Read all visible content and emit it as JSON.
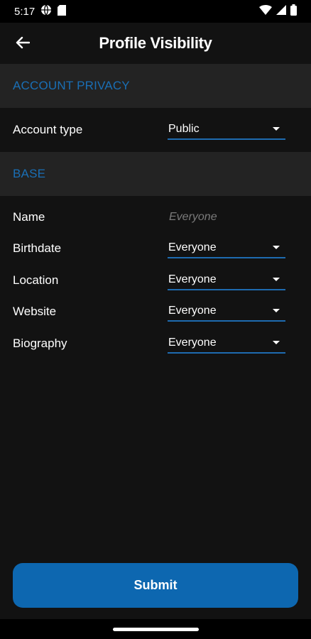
{
  "status_bar": {
    "time": "5:17",
    "icons": [
      "globe-icon",
      "sd-card-icon",
      "wifi-icon",
      "signal-icon",
      "battery-icon"
    ]
  },
  "app_bar": {
    "title": "Profile Visibility",
    "back_icon": "arrow-left-icon"
  },
  "sections": {
    "account_privacy": {
      "header": "ACCOUNT PRIVACY",
      "account_type": {
        "label": "Account type",
        "value": "Public"
      }
    },
    "base": {
      "header": "BASE",
      "name": {
        "label": "Name",
        "value": "Everyone"
      },
      "birthdate": {
        "label": "Birthdate",
        "value": "Everyone"
      },
      "location": {
        "label": "Location",
        "value": "Everyone"
      },
      "website": {
        "label": "Website",
        "value": "Everyone"
      },
      "biography": {
        "label": "Biography",
        "value": "Everyone"
      }
    }
  },
  "submit": {
    "label": "Submit"
  },
  "colors": {
    "accent": "#1a6fb5",
    "button": "#0d67b0",
    "background": "#121212",
    "section_bg": "#232323"
  }
}
